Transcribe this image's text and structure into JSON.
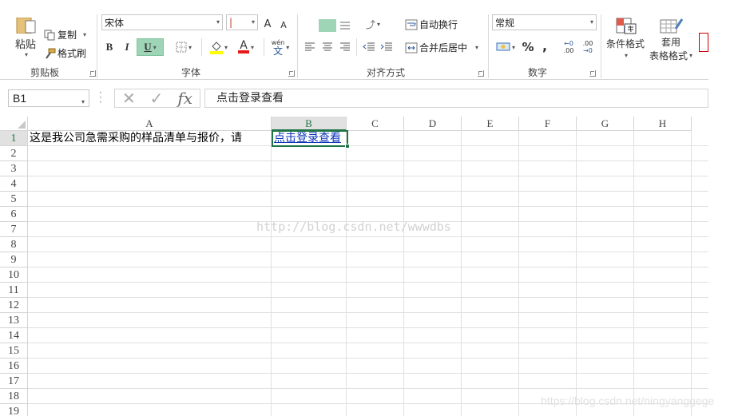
{
  "ribbon": {
    "clipboard": {
      "paste_label": "粘贴",
      "copy_label": "复制",
      "format_painter_label": "格式刷",
      "group_label": "剪贴板"
    },
    "font": {
      "font_name": "宋体",
      "bold": "B",
      "italic": "I",
      "underline": "U",
      "grow": "A",
      "shrink": "A",
      "phonetic": "wén",
      "phonetic_char": "文",
      "group_label": "字体"
    },
    "alignment": {
      "wrap_label": "自动换行",
      "merge_label": "合并后居中",
      "group_label": "对齐方式"
    },
    "number": {
      "format": "常规",
      "percent": "%",
      "comma": ",",
      "inc_decimal": ".00",
      "dec_decimal": ".00",
      "group_label": "数字"
    },
    "styles": {
      "conditional_label": "条件格式",
      "table_label_1": "套用",
      "table_label_2": "表格格式"
    }
  },
  "formula_bar": {
    "name_box": "B1",
    "fx": "fx",
    "content": "点击登录查看"
  },
  "sheet": {
    "columns": [
      "A",
      "B",
      "C",
      "D",
      "E",
      "F",
      "G",
      "H"
    ],
    "rows": [
      "1",
      "2",
      "3",
      "4",
      "5",
      "6",
      "7",
      "8",
      "9",
      "10",
      "11",
      "12",
      "13",
      "14",
      "15",
      "16",
      "17",
      "18",
      "19"
    ],
    "selected_cell": "B1",
    "a1_text": "这是我公司急需采购的样品清单与报价，请",
    "b1_link": "点击登录查看"
  },
  "watermarks": {
    "center": "http://blog.csdn.net/wwwdbs",
    "corner": "https://blog.csdn.net/ningyanggege"
  },
  "colors": {
    "accent": "#217346",
    "link": "#0c33b8",
    "grid": "#e0e0e0"
  }
}
